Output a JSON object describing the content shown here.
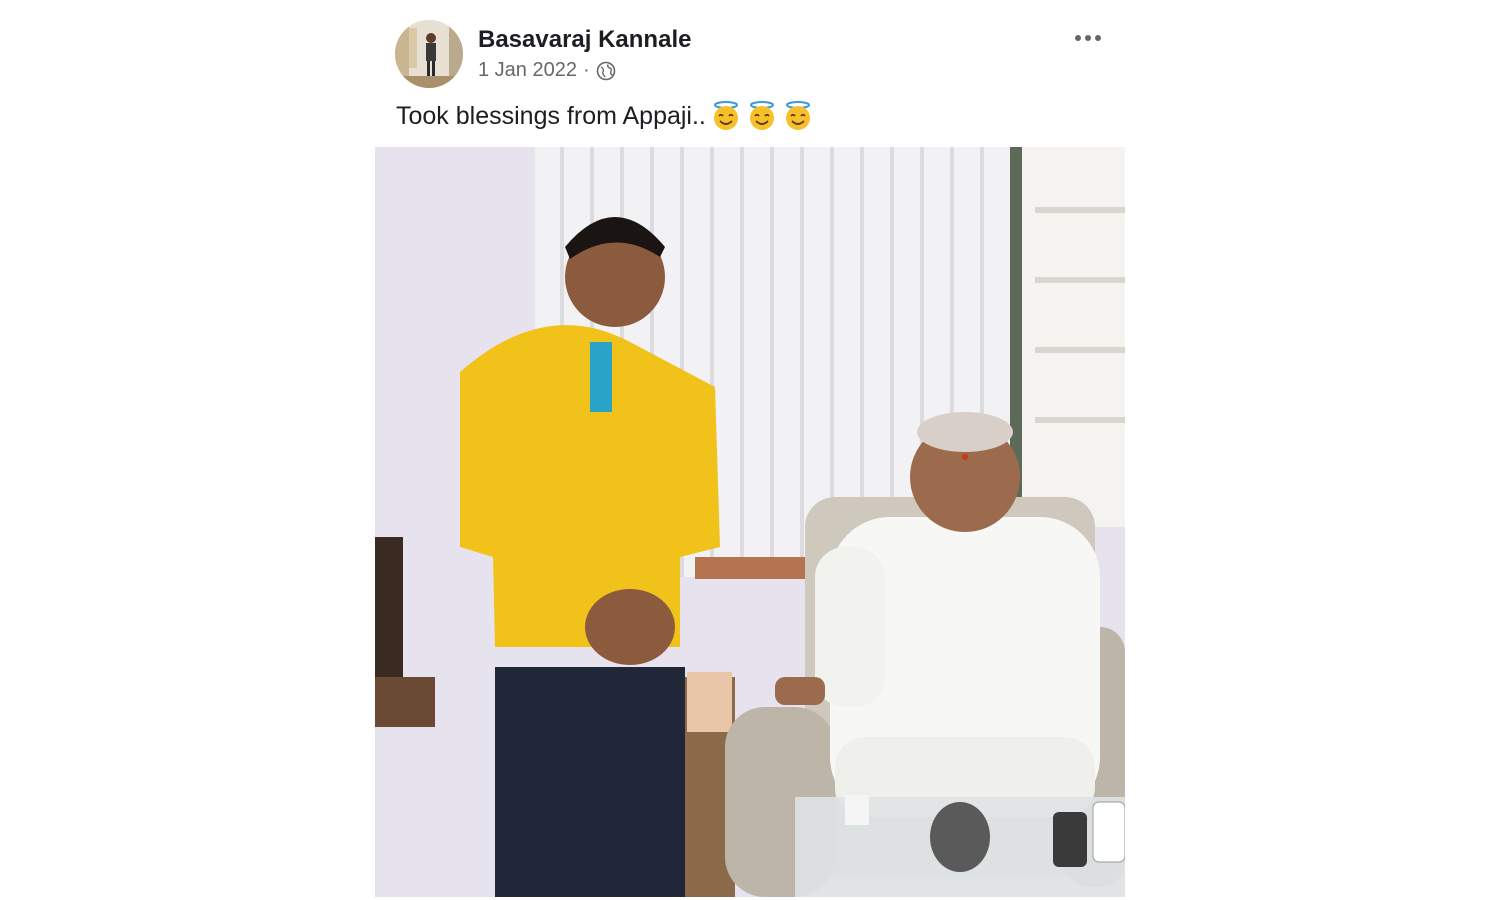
{
  "post": {
    "author": "Basavaraj Kannale",
    "date": "1 Jan 2022",
    "separator": "·",
    "privacy_icon": "globe-icon",
    "more_icon": "more-options-icon",
    "text": "Took blessings from Appaji..",
    "emojis": [
      "smiling-face-with-halo-icon",
      "smiling-face-with-halo-icon",
      "smiling-face-with-halo-icon"
    ],
    "photo_icon": "post-photo"
  },
  "colors": {
    "name": "#1c1e21",
    "meta": "#65676b",
    "emoji": "#f7c02b"
  }
}
